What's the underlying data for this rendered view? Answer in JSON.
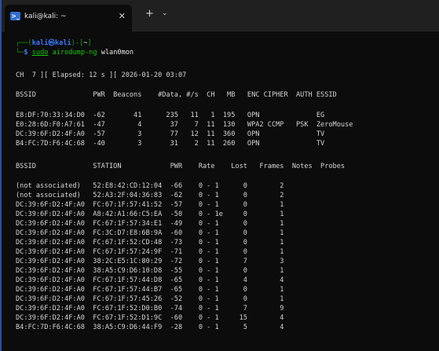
{
  "window": {
    "tab_icon": ">_",
    "tab_title": "kali@kali: ~",
    "tab_close": "✕",
    "new_tab": "+",
    "tab_dropdown": "⌄"
  },
  "colors": {
    "prompt_blue": "#3b78ff",
    "prompt_green": "#13a10e",
    "command_green": "#16c60c",
    "background": "#0c0c0c"
  },
  "prompt": {
    "line1_prefix": "┌──(",
    "user_host": "kali㉿kali",
    "line1_mid": ")-[",
    "cwd": "~",
    "line1_suffix": "]",
    "line2_prefix": "└─",
    "dollar": "$ ",
    "sudo": "sudo",
    "command": "airodump-ng",
    "args": " wlan0mon"
  },
  "status_line": "CH  7 ][ Elapsed: 12 s ][ 2026-01-20 03:07",
  "ap_table": {
    "header": "BSSID              PWR  Beacons    #Data, #/s  CH   MB   ENC CIPHER  AUTH ESSID",
    "rows": [
      "E8:DF:70:33:34:D0  -62       41      235   11   1  195   OPN              EG",
      "E0:28:6D:F0:A7:61  -47        4       37    7  11  130   WPA2 CCMP   PSK  ZeroMouse",
      "DC:39:6F:D2:4F:A0  -57        3       77   12  11  360   OPN              TV",
      "B4:FC:7D:F6:4C:68  -40        3       31    2  11  260   OPN              TV"
    ]
  },
  "station_table": {
    "header": "BSSID              STATION            PWR    Rate    Lost   Frames  Notes  Probes",
    "rows": [
      "(not associated)   52:E8:42:CD:12:04  -66    0 - 1      0        2",
      "(not associated)   52:A3:2F:04:36:83  -62    0 - 1      0        2",
      "DC:39:6F:D2:4F:A0  FC:67:1F:57:41:52  -57    0 - 1      0        1",
      "DC:39:6F:D2:4F:A0  A8:42:A1:66:C5:EA  -50    0 - 1e     0        1",
      "DC:39:6F:D2:4F:A0  FC:67:1F:57:34:E1  -49    0 - 1      0        1",
      "DC:39:6F:D2:4F:A0  FC:3C:D7:E8:6B:9A  -60    0 - 1      0        1",
      "DC:39:6F:D2:4F:A0  FC:67:1F:52:CD:48  -73    0 - 1      0        1",
      "DC:39:6F:D2:4F:A0  FC:67:1F:57:24:9F  -71    0 - 1      0        1",
      "DC:39:6F:D2:4F:A0  38:2C:E5:1C:80:29  -72    0 - 1      7        3",
      "DC:39:6F:D2:4F:A0  38:A5:C9:D6:10:D8  -55    0 - 1      0        1",
      "DC:39:6F:D2:4F:A0  FC:67:1F:57:44:D8  -65    0 - 1      4        4",
      "DC:39:6F:D2:4F:A0  FC:67:1F:57:44:B7  -65    0 - 1      0        1",
      "DC:39:6F:D2:4F:A0  FC:67:1F:57:45:26  -52    0 - 1      0        1",
      "DC:39:6F:D2:4F:A0  FC:67:1F:52:D0:B0  -74    0 - 1      7        9",
      "DC:39:6F:D2:4F:A0  FC:67:1F:52:D1:9C  -60    0 - 1     15        4",
      "B4:FC:7D:F6:4C:68  38:A5:C9:D6:44:F9  -28    0 - 1      5        4"
    ]
  }
}
